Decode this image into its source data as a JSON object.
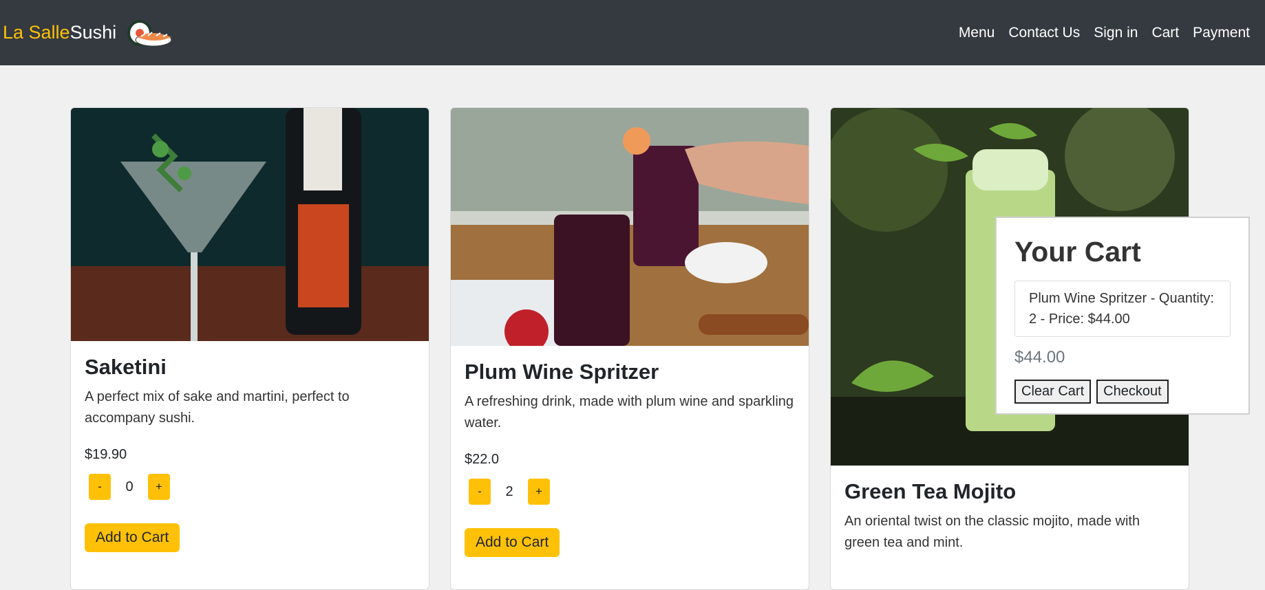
{
  "nav": {
    "brand_accent": "La Salle",
    "brand_rest": "Sushi",
    "logo_icon": "sushi-roll-icon",
    "links": [
      "Menu",
      "Contact Us",
      "Sign in",
      "Cart",
      "Payment"
    ]
  },
  "products": [
    {
      "title": "Saketini",
      "description": "A perfect mix of sake and martini, perfect to accompany sushi.",
      "price": "$19.90",
      "quantity": "0",
      "minus_label": "-",
      "plus_label": "+",
      "add_label": "Add to Cart"
    },
    {
      "title": "Plum Wine Spritzer",
      "description": "A refreshing drink, made with plum wine and sparkling water.",
      "price": "$22.0",
      "quantity": "2",
      "minus_label": "-",
      "plus_label": "+",
      "add_label": "Add to Cart"
    },
    {
      "title": "Green Tea Mojito",
      "description": "An oriental twist on the classic mojito, made with green tea and mint."
    }
  ],
  "cart": {
    "title": "Your Cart",
    "item": "Plum Wine Spritzer - Quantity: 2 - Price: $44.00",
    "total": "$44.00",
    "clear_label": "Clear Cart",
    "checkout_label": "Checkout"
  },
  "colors": {
    "navbar": "#343a40",
    "accent": "#ffc107",
    "background": "#f0f0f0"
  }
}
